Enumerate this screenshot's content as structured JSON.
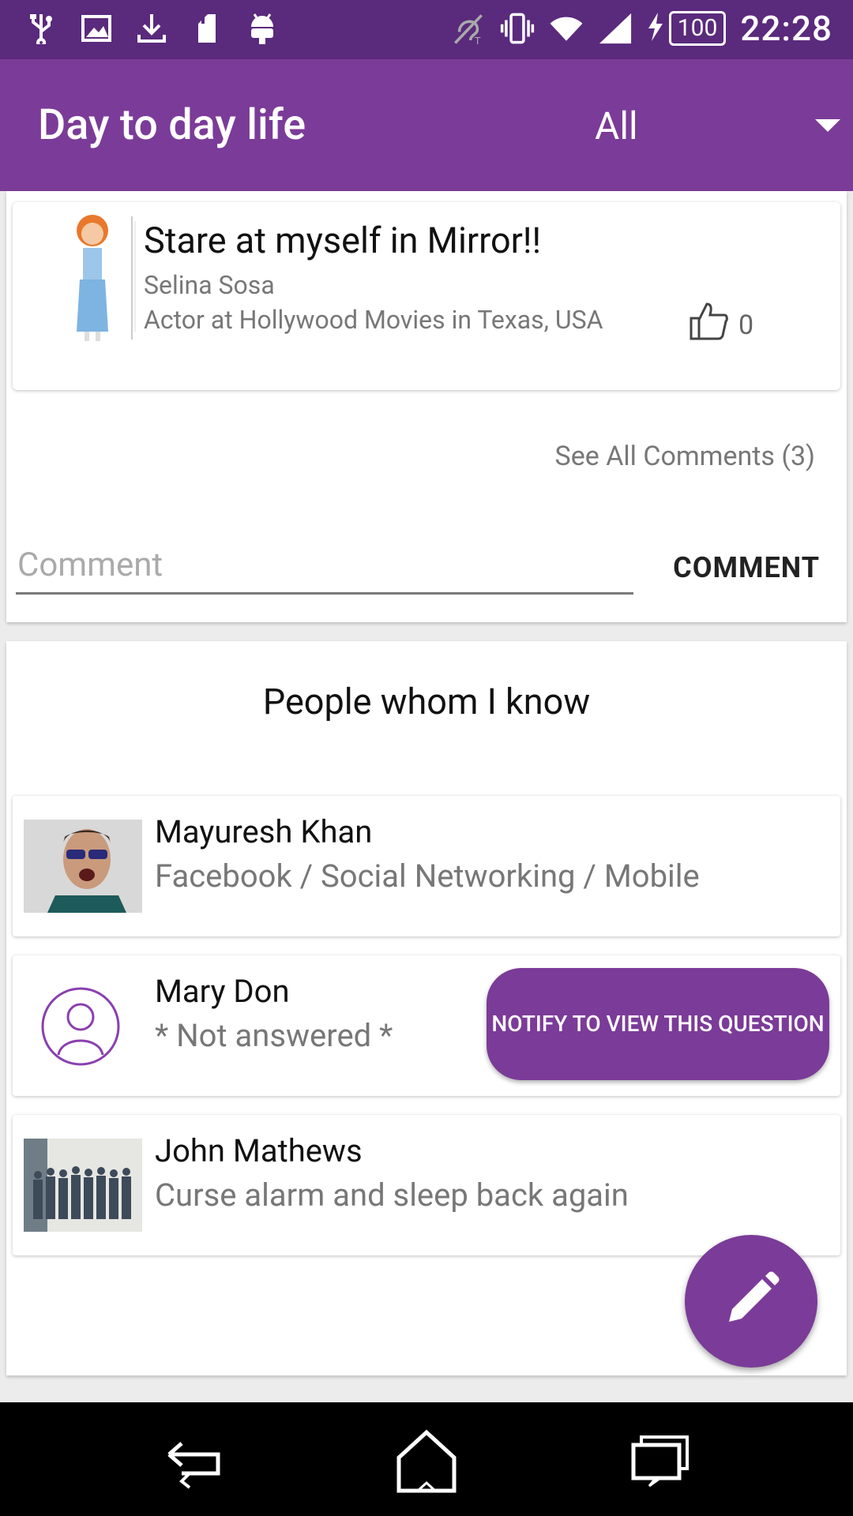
{
  "status_bar": {
    "battery": "100",
    "time": "22:28",
    "left_icons": [
      "usb-icon",
      "image-icon",
      "download-icon",
      "sim-icon",
      "android-icon"
    ],
    "right_icons": [
      "hearing-aid-icon",
      "vibrate-icon",
      "wifi-icon",
      "signal-icon",
      "charging-icon"
    ]
  },
  "app_bar": {
    "title": "Day to day life",
    "filter_value": "All"
  },
  "post": {
    "title": "Stare at myself in Mirror!!",
    "author": "Selina Sosa",
    "occupation": "Actor at Hollywood Movies in Texas, USA",
    "like_count": "0",
    "see_all_comments": "See All Comments (3)",
    "comment_placeholder": "Comment",
    "comment_button": "COMMENT"
  },
  "people_section": {
    "title": "People whom I know",
    "people": [
      {
        "name": "Mayuresh Khan",
        "description": "Facebook / Social Networking / Mobile"
      },
      {
        "name": "Mary Don",
        "description": "* Not answered *",
        "notify_button": "NOTIFY TO VIEW THIS QUESTION"
      },
      {
        "name": "John Mathews",
        "description": "Curse alarm and sleep back again"
      }
    ]
  },
  "colors": {
    "status_bar": "#5a2a7c",
    "primary": "#7b3b98",
    "nav_bar": "#000000"
  },
  "nav_bar": {
    "items": [
      "back-icon",
      "home-icon",
      "recent-apps-icon"
    ]
  }
}
